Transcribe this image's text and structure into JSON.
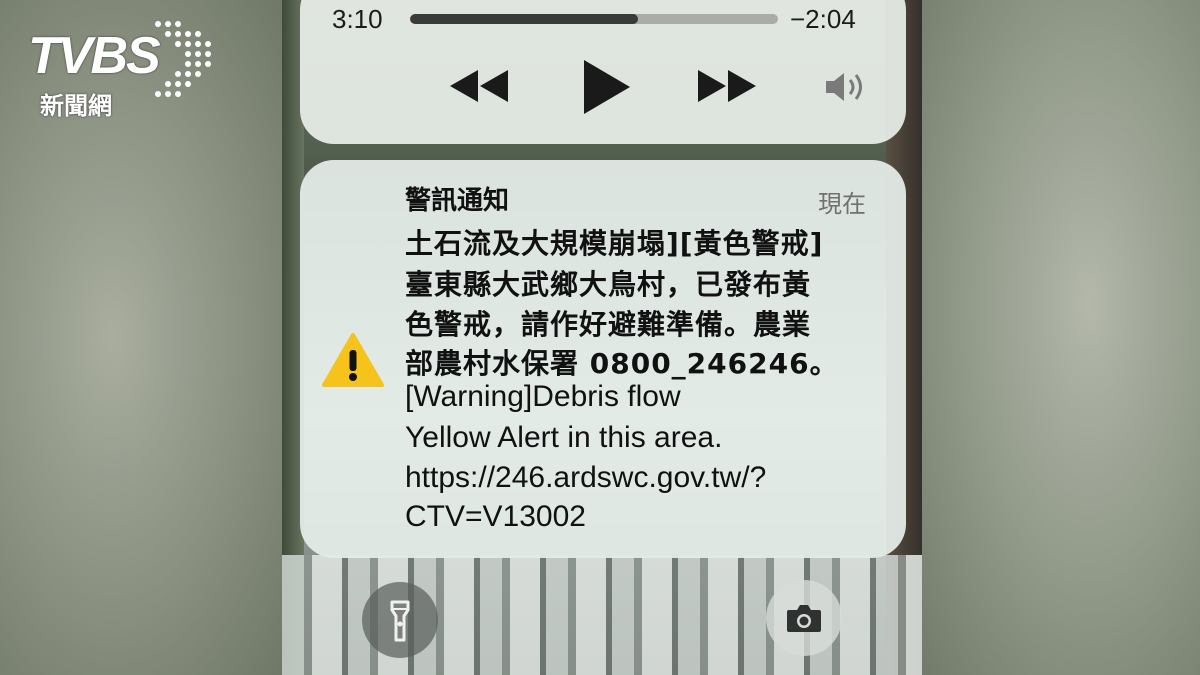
{
  "broadcaster_logo": {
    "letters": "TVBS",
    "subtitle": "新聞網"
  },
  "media_player": {
    "elapsed": "3:10",
    "remaining": "−2:04",
    "progress_fraction": 0.62,
    "controls": [
      "rewind-icon",
      "play-icon",
      "fast-forward-icon",
      "speaker-icon"
    ]
  },
  "alert": {
    "title": "警訊通知",
    "time": "現在",
    "icon": "warning-triangle-icon",
    "icon_color": "#f5c31c",
    "lines": [
      "土石流及大規模崩塌][黃色警戒]",
      "臺東縣大武鄉大鳥村，已發布黃",
      "色警戒，請作好避難準備。農業",
      "部農村水保署 0800_246246。",
      "[Warning]Debris flow",
      "Yellow Alert in this area.",
      "https://246.ardswc.gov.tw/?",
      "CTV=V13002"
    ]
  },
  "lock_screen_buttons": {
    "left": "flashlight-icon",
    "right": "camera-icon"
  }
}
